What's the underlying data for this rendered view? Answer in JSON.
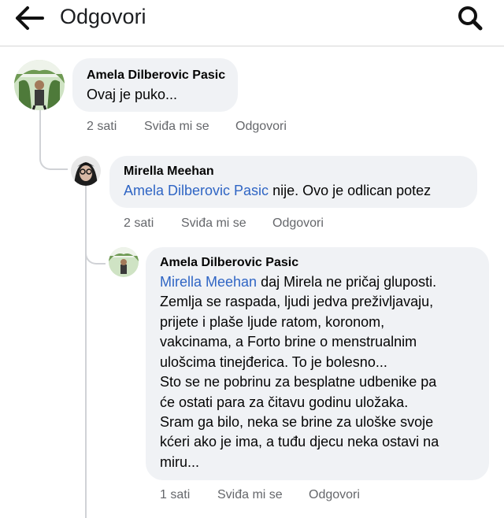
{
  "header": {
    "title": "Odgovori",
    "back_icon": "arrow-left-icon",
    "search_icon": "search-icon"
  },
  "comments": [
    {
      "author": "Amela Dilberovic Pasic",
      "lines": [
        "Ovaj je puko..."
      ],
      "time": "2 sati",
      "like_label": "Sviđa mi se",
      "reply_label": "Odgovori"
    },
    {
      "author": "Mirella Meehan",
      "mention": "Amela Dilberovic Pasic",
      "first_line_rest": " nije. Ovo je odlican potez",
      "time": "2 sati",
      "like_label": "Sviđa mi se",
      "reply_label": "Odgovori"
    },
    {
      "author": "Amela Dilberovic Pasic",
      "mention": "Mirella Meehan",
      "first_line_rest": " daj Mirela ne pričaj gluposti.",
      "lines": [
        "Zemlja se raspada, ljudi jedva preživljavaju,",
        "prijete i plaše ljude ratom, koronom,",
        "vakcinama, a Forto brine o menstrualnim",
        "ulošcima tinejđerica. To je bolesno...",
        "Sto se ne pobrinu za besplatne udbenike pa",
        "će ostati para za čitavu godinu uložaka.",
        "Sram ga bilo, neka se brine za uloške svoje",
        "kćeri ako je ima, a tuđu djecu neka ostavi na",
        "miru..."
      ],
      "time": "1 sati",
      "like_label": "Sviđa mi se",
      "reply_label": "Odgovori"
    }
  ]
}
